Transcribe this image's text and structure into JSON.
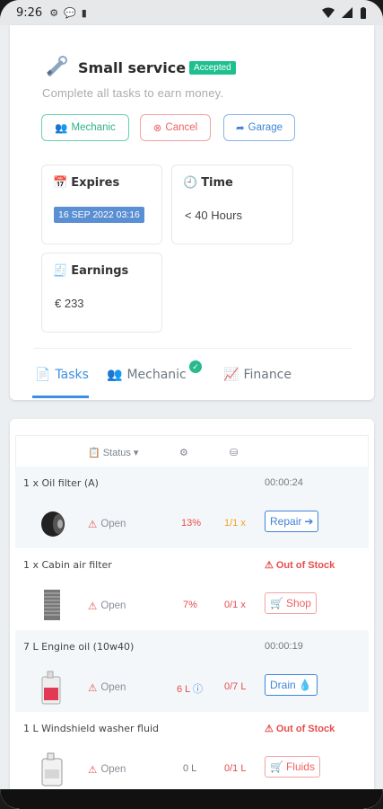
{
  "status_bar": {
    "time": "9:26"
  },
  "service": {
    "title": "Small service",
    "badge": "Accepted",
    "subtitle": "Complete all tasks to earn money."
  },
  "buttons": {
    "mechanic": "Mechanic",
    "cancel": "Cancel",
    "garage": "Garage"
  },
  "stats": {
    "expires_label": "Expires",
    "expires_value": "16 SEP 2022 03:16",
    "time_label": "Time",
    "time_value": "< 40 Hours",
    "earnings_label": "Earnings",
    "earnings_value": "€ 233"
  },
  "tabs": {
    "tasks": "Tasks",
    "mechanic": "Mechanic",
    "finance": "Finance"
  },
  "table": {
    "status_header": "Status",
    "rows": [
      {
        "name": "1 x Oil filter (A)",
        "timer": "00:00:24",
        "status": "Open",
        "qty": "13%",
        "ratio": "1/1 x",
        "action": "Repair"
      },
      {
        "name": "1 x Cabin air filter",
        "oos": "Out of Stock",
        "status": "Open",
        "qty": "7%",
        "ratio": "0/1 x",
        "action": "Shop"
      },
      {
        "name": "7 L Engine oil (10w40)",
        "timer": "00:00:19",
        "status": "Open",
        "qty": "6 L",
        "ratio": "0/7 L",
        "action": "Drain"
      },
      {
        "name": "1 L Windshield washer fluid",
        "oos": "Out of Stock",
        "status": "Open",
        "qty": "0 L",
        "ratio": "0/1 L",
        "action": "Fluids"
      }
    ]
  },
  "colors": {
    "accent": "#3d8ee0",
    "accepted": "#1ec08f",
    "danger": "#e74c4c",
    "warning": "#f0a020"
  }
}
